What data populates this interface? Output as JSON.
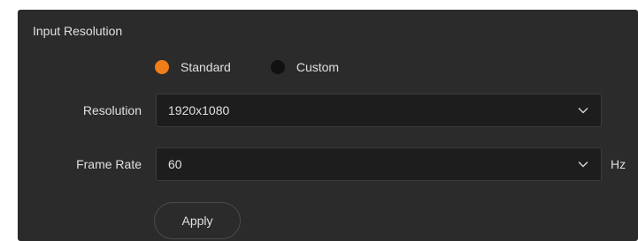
{
  "section": {
    "title": "Input Resolution"
  },
  "mode": {
    "options": [
      {
        "label": "Standard",
        "checked": true
      },
      {
        "label": "Custom",
        "checked": false
      }
    ]
  },
  "fields": {
    "resolution": {
      "label": "Resolution",
      "value": "1920x1080",
      "icon": "chevron-down-icon"
    },
    "frame_rate": {
      "label": "Frame Rate",
      "value": "60",
      "unit": "Hz",
      "icon": "chevron-down-icon"
    }
  },
  "actions": {
    "apply_label": "Apply"
  },
  "colors": {
    "panel_bg": "#2b2b2b",
    "select_bg": "#1d1d1d",
    "accent": "#ef7d1a",
    "text": "#e0e0e0"
  }
}
